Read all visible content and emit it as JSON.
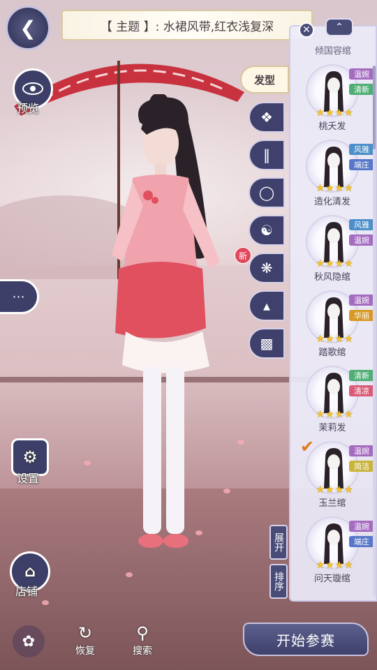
{
  "theme": {
    "text": "【 主题 】: 水裙风带,红衣浅复深"
  },
  "left": {
    "preview_label": "预览",
    "settings_label": "设置",
    "shop_label": "店铺"
  },
  "bottom": {
    "restore_label": "恢复",
    "search_label": "搜索",
    "start_label": "开始参赛"
  },
  "category": {
    "active_label": "发型",
    "new_badge": "新"
  },
  "side_tabs": {
    "expand_label": "展开",
    "sort_label": "排序"
  },
  "panel": {
    "header": "倾国容绾",
    "items": [
      {
        "name": "桃夭发",
        "tags": [
          "温婉",
          "清新"
        ],
        "stars": 4,
        "selected": false
      },
      {
        "name": "造化清发",
        "tags": [
          "风雅",
          "端庄"
        ],
        "stars": 4,
        "selected": false
      },
      {
        "name": "秋风隐绾",
        "tags": [
          "风雅",
          "温婉"
        ],
        "stars": 4,
        "selected": false
      },
      {
        "name": "踏歌绾",
        "tags": [
          "温婉",
          "华丽"
        ],
        "stars": 4,
        "selected": false
      },
      {
        "name": "茉莉发",
        "tags": [
          "清新",
          "清凉"
        ],
        "stars": 4,
        "selected": false
      },
      {
        "name": "玉兰绾",
        "tags": [
          "温婉",
          "简洁"
        ],
        "stars": 4,
        "selected": true
      },
      {
        "name": "问天璇绾",
        "tags": [
          "温婉",
          "端庄"
        ],
        "stars": 4,
        "selected": false
      }
    ]
  },
  "colors": {
    "tag_温婉": "#a46bc0",
    "tag_清新": "#4fae74",
    "tag_风雅": "#4c8fc9",
    "tag_端庄": "#5877c9",
    "tag_华丽": "#d79a28",
    "tag_清凉": "#d95b78",
    "tag_简洁": "#c9b43a",
    "accent": "#3f416c",
    "dress": "#e86c78"
  }
}
